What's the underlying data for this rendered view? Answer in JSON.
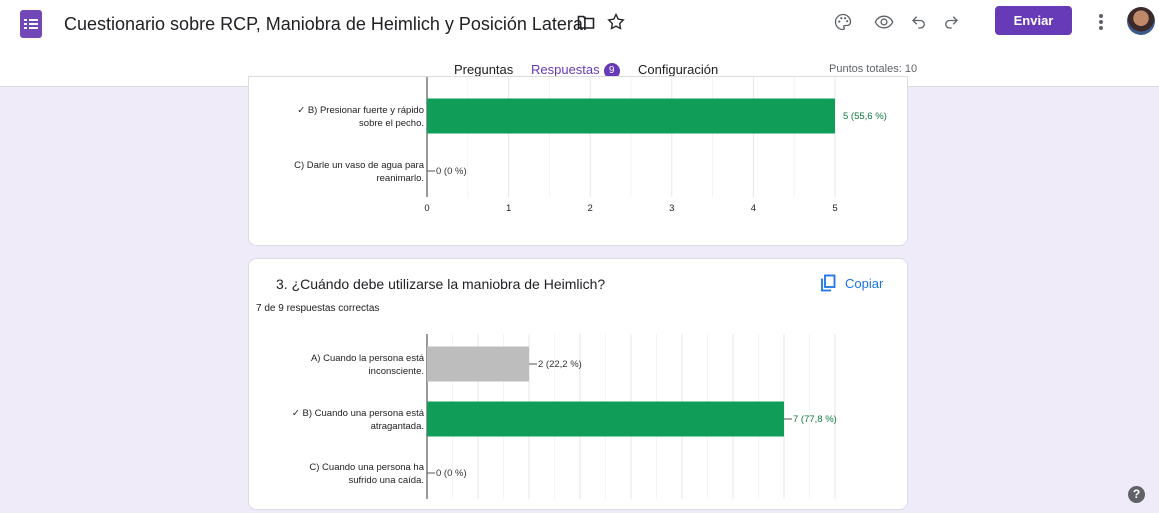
{
  "header": {
    "title": "Cuestionario sobre RCP, Maniobra de Heimlich y Posición Lateral de Segu",
    "send_label": "Enviar"
  },
  "tabs": {
    "questions": "Preguntas",
    "responses": "Respuestas",
    "responses_count": "9",
    "settings": "Configuración",
    "total_points": "Puntos totales: 10"
  },
  "colors": {
    "accent": "#673ab7",
    "correct": "#0f9d58",
    "incorrect": "#bdbdbd",
    "link": "#1a73e8"
  },
  "icons": [
    "forms-logo-icon",
    "folder-icon",
    "star-icon",
    "palette-icon",
    "eye-icon",
    "undo-icon",
    "redo-icon",
    "more-vert-icon",
    "copy-icon",
    "help-icon"
  ],
  "cards": [
    {
      "chart_data": {
        "type": "bar",
        "orientation": "horizontal",
        "categories": [
          "✓ B) Presionar fuerte y rápido sobre el pecho.",
          "C) Darle un vaso de agua para reanimarlo."
        ],
        "category_lines": [
          [
            "✓ B) Presionar fuerte y rápido",
            "sobre el pecho."
          ],
          [
            "C) Darle un vaso de agua para",
            "reanimarlo."
          ]
        ],
        "values": [
          5,
          0
        ],
        "value_labels": [
          "5 (55,6 %)",
          "0 (0 %)"
        ],
        "correct": [
          true,
          false
        ],
        "x_ticks": [
          "0",
          "1",
          "2",
          "3",
          "4",
          "5"
        ],
        "xlim": [
          0,
          5
        ],
        "grid": true
      }
    },
    {
      "question": "3. ¿Cuándo debe utilizarse la maniobra de Heimlich?",
      "summary": "7 de 9 respuestas correctas",
      "copy_label": "Copiar",
      "chart_data": {
        "type": "bar",
        "orientation": "horizontal",
        "categories": [
          "A) Cuando la persona está inconsciente.",
          "✓ B) Cuando una persona está atragantada.",
          "C) Cuando una persona ha sufrido una caída."
        ],
        "category_lines": [
          [
            "A) Cuando la persona está",
            "inconsciente."
          ],
          [
            "✓ B) Cuando una persona está",
            "atragantada."
          ],
          [
            "C) Cuando una persona ha",
            "sufrido una caída."
          ]
        ],
        "values": [
          2,
          7,
          0
        ],
        "value_labels": [
          "2 (22,2 %)",
          "7 (77,8 %)",
          "0 (0 %)"
        ],
        "correct": [
          false,
          true,
          false
        ],
        "xlim": [
          0,
          8
        ],
        "grid": true
      }
    }
  ]
}
